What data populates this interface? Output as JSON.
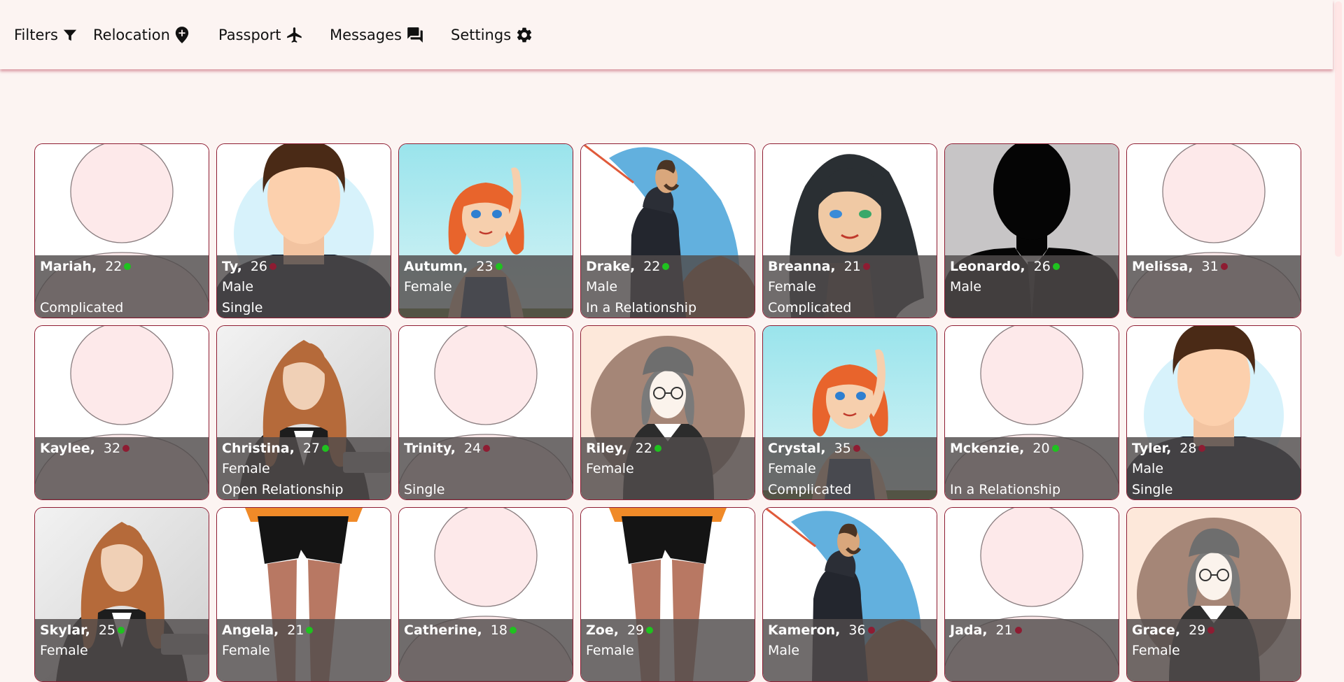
{
  "nav": {
    "items": [
      {
        "label": "Filters",
        "icon": "filter-icon"
      },
      {
        "label": "Relocation",
        "icon": "location-pin-icon"
      },
      {
        "label": "Passport",
        "icon": "airplane-icon"
      },
      {
        "label": "Messages",
        "icon": "chat-icon"
      },
      {
        "label": "Settings",
        "icon": "gear-icon"
      }
    ]
  },
  "colors": {
    "online": "#1fc21f",
    "offline": "#8e1c32",
    "card_border": "#8e1c32",
    "page_bg": "#fcf4f2",
    "overlay": "rgba(80,76,76,0.82)"
  },
  "profiles": [
    {
      "name": "Mariah,",
      "age": "22",
      "online": true,
      "gender": "",
      "status": "Complicated",
      "avatar": "placeholder"
    },
    {
      "name": "Ty,",
      "age": "26",
      "online": false,
      "gender": "Male",
      "status": "Single",
      "avatar": "male-faceless"
    },
    {
      "name": "Autumn,",
      "age": "23",
      "online": true,
      "gender": "Female",
      "status": "",
      "avatar": "redhead-girl"
    },
    {
      "name": "Drake,",
      "age": "22",
      "online": true,
      "gender": "Male",
      "status": "In a Relationship",
      "avatar": "hooded-man"
    },
    {
      "name": "Breanna,",
      "age": "21",
      "online": false,
      "gender": "Female",
      "status": "Complicated",
      "avatar": "dark-hair-girl"
    },
    {
      "name": "Leonardo,",
      "age": "26",
      "online": true,
      "gender": "Male",
      "status": "",
      "avatar": "silhouette-man"
    },
    {
      "name": "Melissa,",
      "age": "31",
      "online": false,
      "gender": "",
      "status": "",
      "avatar": "placeholder"
    },
    {
      "name": "Kaylee,",
      "age": "32",
      "online": false,
      "gender": "",
      "status": "",
      "avatar": "placeholder"
    },
    {
      "name": "Christina,",
      "age": "27",
      "online": true,
      "gender": "Female",
      "status": "Open Relationship",
      "avatar": "auburn-woman"
    },
    {
      "name": "Trinity,",
      "age": "24",
      "online": false,
      "gender": "",
      "status": "Single",
      "avatar": "placeholder"
    },
    {
      "name": "Riley,",
      "age": "22",
      "online": true,
      "gender": "Female",
      "status": "",
      "avatar": "sketch-girl"
    },
    {
      "name": "Crystal,",
      "age": "35",
      "online": false,
      "gender": "Female",
      "status": "Complicated",
      "avatar": "redhead-girl"
    },
    {
      "name": "Mckenzie,",
      "age": "20",
      "online": true,
      "gender": "",
      "status": "In a Relationship",
      "avatar": "placeholder"
    },
    {
      "name": "Tyler,",
      "age": "28",
      "online": false,
      "gender": "Male",
      "status": "Single",
      "avatar": "male-faceless"
    },
    {
      "name": "Skylar,",
      "age": "25",
      "online": true,
      "gender": "Female",
      "status": "",
      "avatar": "auburn-woman"
    },
    {
      "name": "Angela,",
      "age": "21",
      "online": true,
      "gender": "Female",
      "status": "",
      "avatar": "legs-shorts"
    },
    {
      "name": "Catherine,",
      "age": "18",
      "online": true,
      "gender": "",
      "status": "",
      "avatar": "placeholder"
    },
    {
      "name": "Zoe,",
      "age": "29",
      "online": true,
      "gender": "Female",
      "status": "",
      "avatar": "legs-shorts"
    },
    {
      "name": "Kameron,",
      "age": "36",
      "online": false,
      "gender": "Male",
      "status": "",
      "avatar": "hooded-man"
    },
    {
      "name": "Jada,",
      "age": "21",
      "online": false,
      "gender": "",
      "status": "",
      "avatar": "placeholder"
    },
    {
      "name": "Grace,",
      "age": "29",
      "online": false,
      "gender": "Female",
      "status": "",
      "avatar": "sketch-girl"
    }
  ]
}
